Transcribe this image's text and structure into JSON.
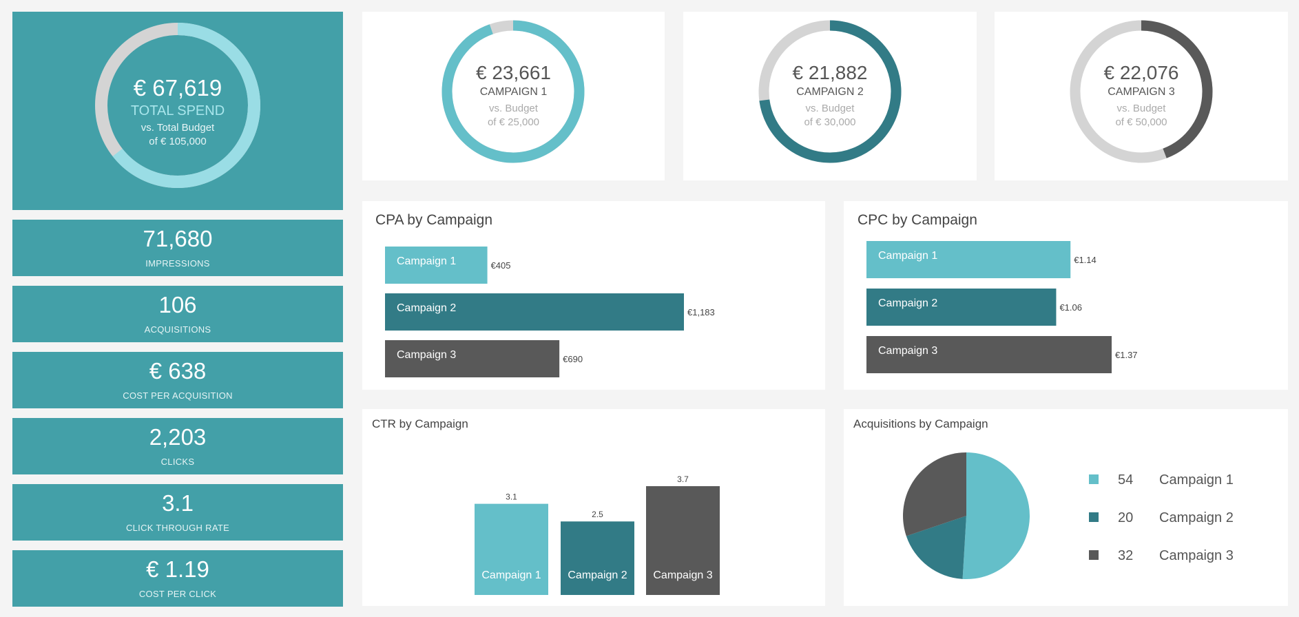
{
  "colors": {
    "campaign1": "#64bfc9",
    "campaign2": "#327b86",
    "campaign3": "#595959",
    "remainder": "#d4d4d4",
    "total_arc": "#9adde5",
    "panel_teal": "#43a0a8"
  },
  "total": {
    "value": "€ 67,619",
    "label": "TOTAL SPEND",
    "sub1": "vs. Total Budget",
    "sub2": "of € 105,000",
    "ratio": 0.644
  },
  "kpis": [
    {
      "value": "71,680",
      "label": "IMPRESSIONS"
    },
    {
      "value": "106",
      "label": "ACQUISITIONS"
    },
    {
      "value": "€ 638",
      "label": "COST PER ACQUISITION"
    },
    {
      "value": "2,203",
      "label": "CLICKS"
    },
    {
      "value": "3.1",
      "label": "CLICK THROUGH RATE"
    },
    {
      "value": "€ 1.19",
      "label": "COST PER CLICK"
    }
  ],
  "campaign_donuts": [
    {
      "value": "€ 23,661",
      "name": "CAMPAIGN 1",
      "sub1": "vs. Budget",
      "sub2": "of € 25,000",
      "ratio": 0.946
    },
    {
      "value": "€ 21,882",
      "name": "CAMPAIGN 2",
      "sub1": "vs. Budget",
      "sub2": "of € 30,000",
      "ratio": 0.729
    },
    {
      "value": "€ 22,076",
      "name": "CAMPAIGN 3",
      "sub1": "vs. Budget",
      "sub2": "of € 50,000",
      "ratio": 0.442
    }
  ],
  "chart_data": [
    {
      "type": "bar",
      "orientation": "horizontal",
      "title": "CPA by Campaign",
      "categories": [
        "Campaign 1",
        "Campaign 2",
        "Campaign 3"
      ],
      "values": [
        405,
        1183,
        690
      ],
      "value_labels": [
        "€405",
        "€1,183",
        "€690"
      ]
    },
    {
      "type": "bar",
      "orientation": "horizontal",
      "title": "CPC by Campaign",
      "categories": [
        "Campaign 1",
        "Campaign 2",
        "Campaign 3"
      ],
      "values": [
        1.14,
        1.06,
        1.37
      ],
      "value_labels": [
        "€1.14",
        "€1.06",
        "€1.37"
      ]
    },
    {
      "type": "bar",
      "orientation": "vertical",
      "title": "CTR by Campaign",
      "categories": [
        "Campaign 1",
        "Campaign 2",
        "Campaign 3"
      ],
      "values": [
        3.1,
        2.5,
        3.7
      ],
      "value_labels": [
        "3.1",
        "2.5",
        "3.7"
      ]
    },
    {
      "type": "pie",
      "title": "Acquisitions by Campaign",
      "categories": [
        "Campaign 1",
        "Campaign 2",
        "Campaign 3"
      ],
      "values": [
        54,
        20,
        32
      ],
      "legend": "right"
    }
  ]
}
